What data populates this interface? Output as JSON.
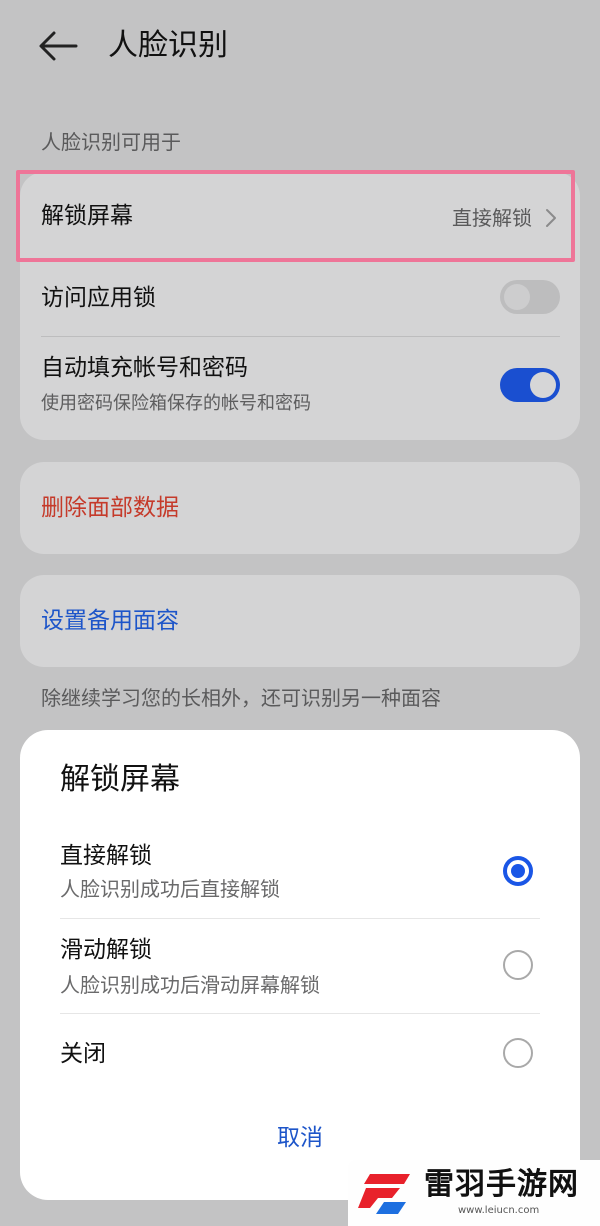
{
  "header": {
    "title": "人脸识别",
    "back_icon": "arrow-left-icon"
  },
  "section_label": "人脸识别可用于",
  "settings": {
    "unlock_screen": {
      "label": "解锁屏幕",
      "value": "直接解锁",
      "icon": "chevron-right-icon"
    },
    "app_lock": {
      "label": "访问应用锁",
      "enabled": false
    },
    "autofill": {
      "label": "自动填充帐号和密码",
      "description": "使用密码保险箱保存的帐号和密码",
      "enabled": true
    }
  },
  "delete_face": {
    "label": "删除面部数据",
    "color": "#c53a2a"
  },
  "alt_face": {
    "label": "设置备用面容",
    "color": "#1d55c9"
  },
  "footnote": "除继续学习您的长相外，还可识别另一种面容",
  "sheet": {
    "title": "解锁屏幕",
    "options": [
      {
        "label": "直接解锁",
        "description": "人脸识别成功后直接解锁",
        "selected": true
      },
      {
        "label": "滑动解锁",
        "description": "人脸识别成功后滑动屏幕解锁",
        "selected": false
      },
      {
        "label": "关闭",
        "description": "",
        "selected": false
      }
    ],
    "cancel": "取消"
  },
  "watermark": {
    "text": "雷羽手游网",
    "url": "www.leiucn.com"
  },
  "colors": {
    "accent": "#1a56e6",
    "highlight": "#ee7598",
    "background": "#c3c3c4"
  }
}
